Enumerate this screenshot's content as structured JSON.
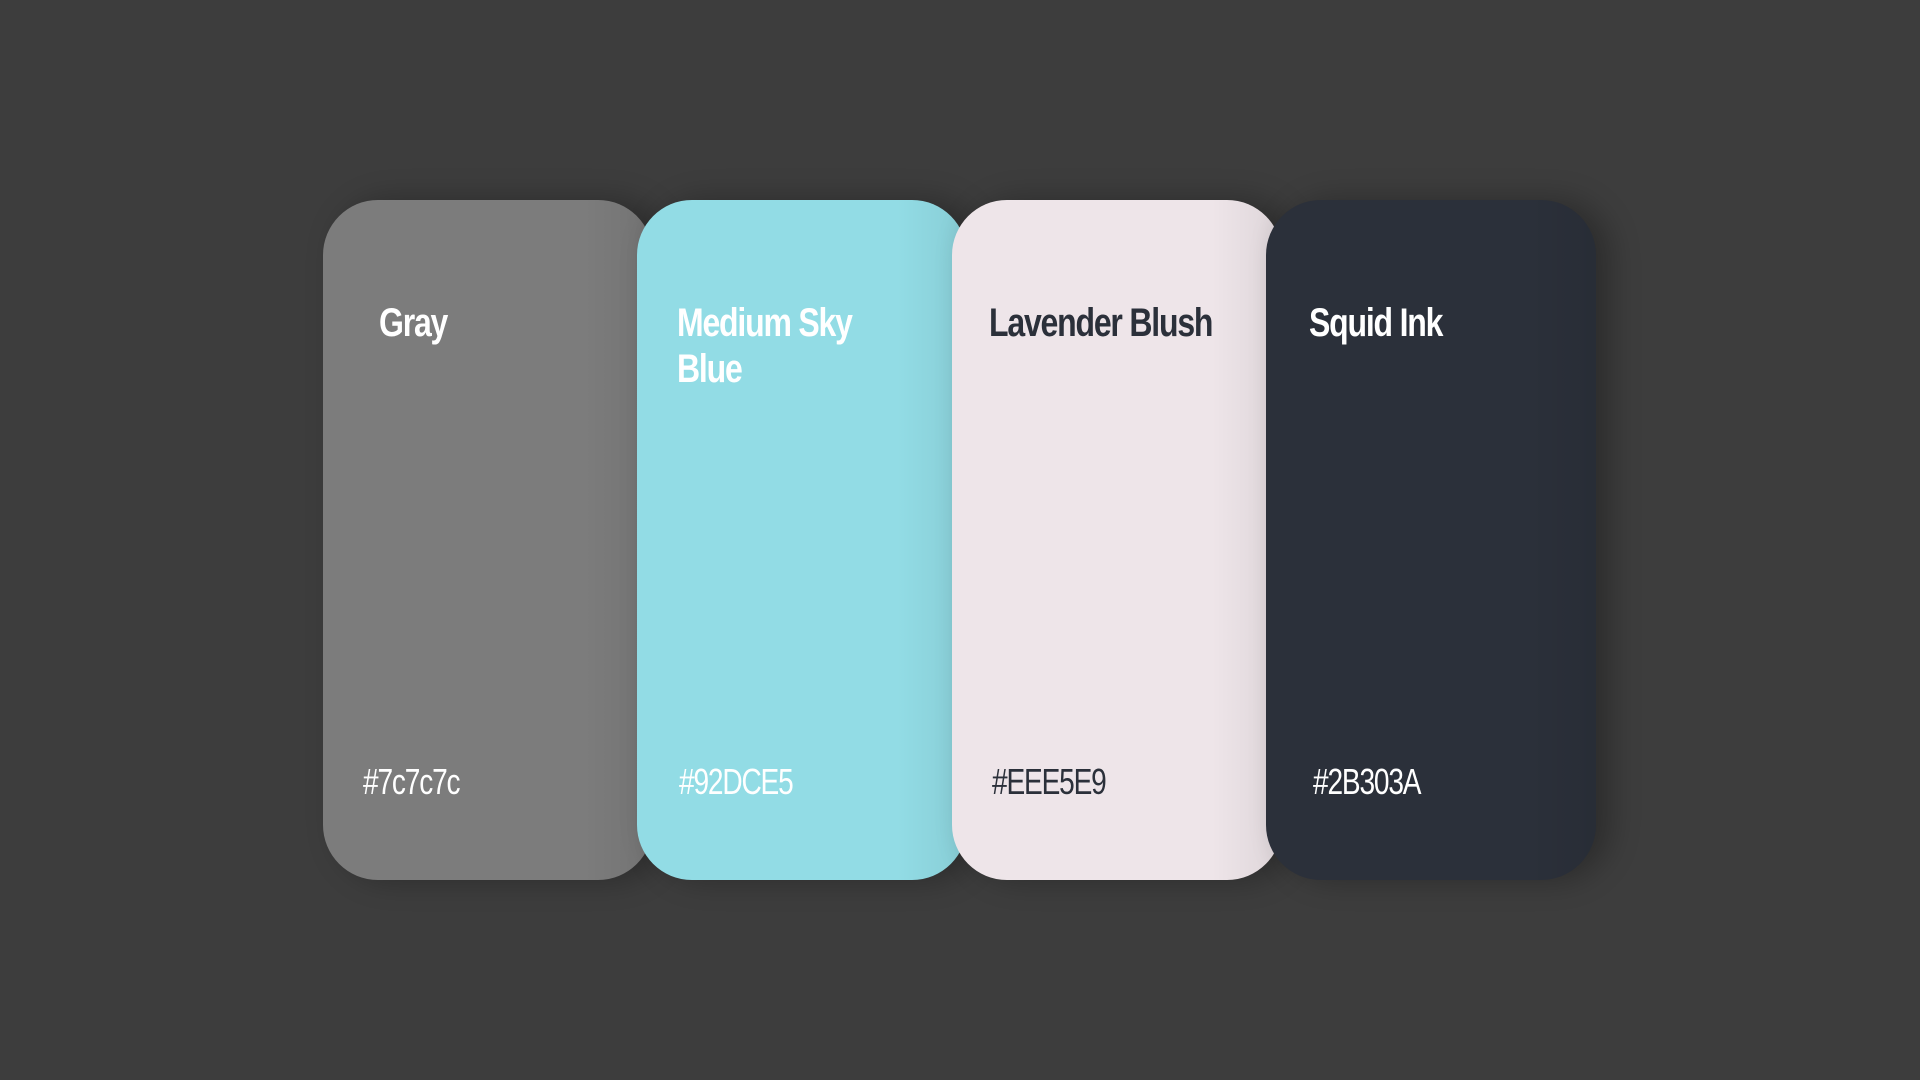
{
  "palette": {
    "swatches": [
      {
        "name": "Gray",
        "hex": "#7c7c7c",
        "color": "#7c7c7c",
        "text_color": "#ffffff"
      },
      {
        "name": "Medium Sky Blue",
        "hex": "#92DCE5",
        "color": "#92dce5",
        "text_color": "#ffffff"
      },
      {
        "name": "Lavender Blush",
        "hex": "#EEE5E9",
        "color": "#eee5e9",
        "text_color": "#2b303a"
      },
      {
        "name": "Squid Ink",
        "hex": "#2B303A",
        "color": "#2b303a",
        "text_color": "#ffffff"
      }
    ],
    "background_color": "#3d3d3d"
  }
}
